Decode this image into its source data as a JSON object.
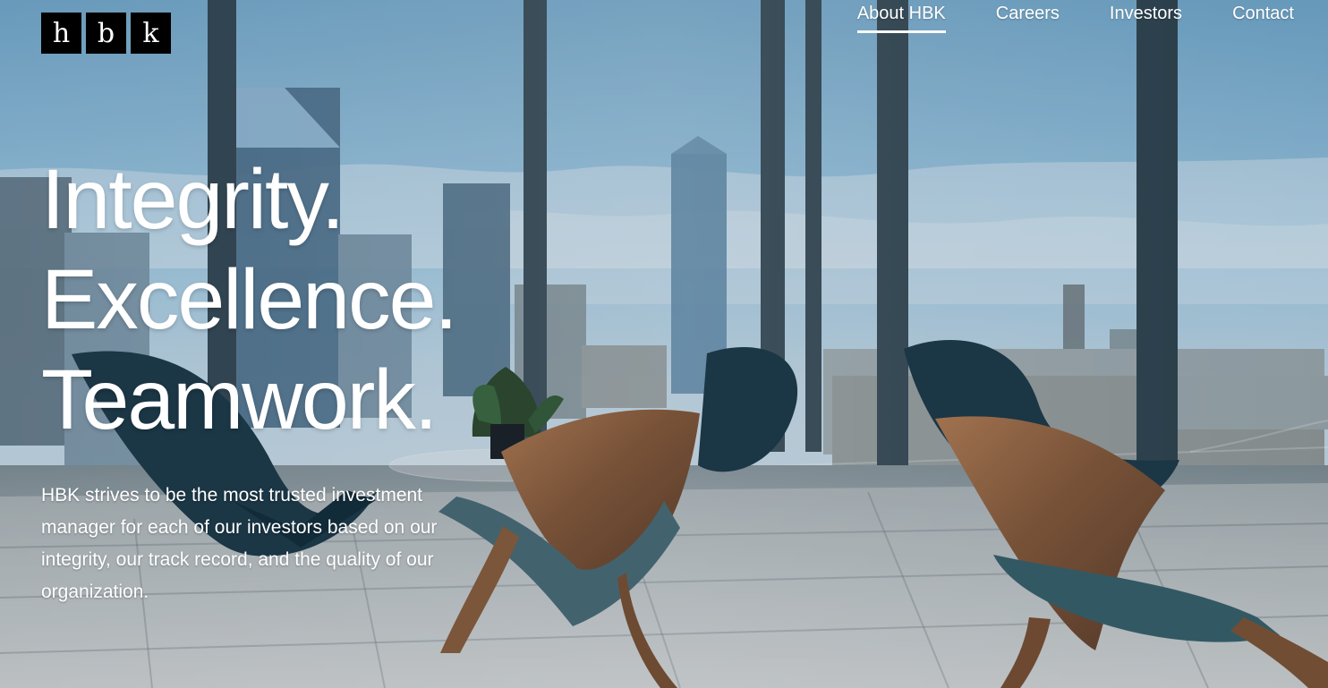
{
  "brand": {
    "logo_letters": [
      "h",
      "b",
      "k"
    ],
    "logo_colors": {
      "background": "#000000",
      "text": "#ffffff"
    }
  },
  "navigation": {
    "items": [
      {
        "label": "About HBK",
        "active": true
      },
      {
        "label": "Careers",
        "active": false
      },
      {
        "label": "Investors",
        "active": false
      },
      {
        "label": "Contact",
        "active": false
      }
    ]
  },
  "hero": {
    "headline_lines": [
      "Integrity.",
      "Excellence.",
      "Teamwork."
    ],
    "description": "HBK strives to be the most trusted investment manager for each of our investors based on our integrity, our track record, and the quality of our organization.",
    "background_scene": {
      "icon": "office-city-view-icon",
      "primary_colors": {
        "sky": "#9dcae6",
        "glass": "#2f5670",
        "wood": "#8a5d3d",
        "chair_fabric": "#163948",
        "floor": "#c8c9c7"
      }
    }
  }
}
